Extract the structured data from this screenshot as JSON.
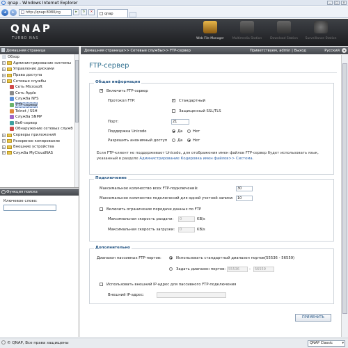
{
  "window": {
    "title": "qnap - Windows Internet Explorer"
  },
  "browser": {
    "url": "http://qnap:8080/cg",
    "tab_label": "qnap"
  },
  "header": {
    "logo": "QNAP",
    "subtitle": "TURBO NAS",
    "apps": [
      {
        "label": "Web File Manager"
      },
      {
        "label": "Multimedia Station"
      },
      {
        "label": "Download Station"
      },
      {
        "label": "Surveillance Station"
      }
    ]
  },
  "breadcrumb": {
    "path": "Домашняя страница>> Сетевые службы>> FTP-сервер",
    "welcome": "Приветствуем, admin | Выход",
    "language": "Русский"
  },
  "sidebar": {
    "title": "Домашняя страница",
    "items": [
      {
        "label": "Обзор",
        "type": "leaf",
        "depth": 0
      },
      {
        "label": "Администрирование системы",
        "type": "folder",
        "depth": 0
      },
      {
        "label": "Управление дисками",
        "type": "folder",
        "depth": 0
      },
      {
        "label": "Права доступа",
        "type": "folder",
        "depth": 0
      },
      {
        "label": "Сетевые службы",
        "type": "folder-open",
        "depth": 0
      },
      {
        "label": "Сеть Microsoft",
        "type": "leaf",
        "depth": 1
      },
      {
        "label": "Сеть Apple",
        "type": "leaf",
        "depth": 1
      },
      {
        "label": "Служба NFS",
        "type": "leaf",
        "depth": 1
      },
      {
        "label": "FTP-сервер",
        "type": "leaf",
        "depth": 1,
        "selected": true
      },
      {
        "label": "Telnet / SSH",
        "type": "leaf",
        "depth": 1
      },
      {
        "label": "Служба SNMP",
        "type": "leaf",
        "depth": 1
      },
      {
        "label": "Веб-сервер",
        "type": "leaf",
        "depth": 1
      },
      {
        "label": "Обнаружение сетевых служб",
        "type": "leaf",
        "depth": 1
      },
      {
        "label": "Серверы приложений",
        "type": "folder",
        "depth": 0
      },
      {
        "label": "Резервное копирование",
        "type": "folder",
        "depth": 0
      },
      {
        "label": "Внешние устройства",
        "type": "folder",
        "depth": 0
      },
      {
        "label": "Служба MyCloudNAS",
        "type": "folder",
        "depth": 0
      }
    ],
    "search_title": "Функция поиска",
    "search_label": "Ключевое слово:"
  },
  "main": {
    "title": "FTP-сервер",
    "general": {
      "legend": "Общая информация",
      "enable_ftp": "Включить FTP-сервер",
      "protocol_label": "Протокол FTP:",
      "protocol_standard": "Стандартный",
      "protocol_ssl": "Защищенный SSL/TLS",
      "port_label": "Порт:",
      "port_value": "21",
      "unicode_label": "Поддержка Unicode",
      "anon_label": "Разрешить анонимный доступ",
      "yes": "Да",
      "no": "Нет",
      "note": "Если FTP-клиент не поддерживает Unicode, для отображения имен файлов FTP-сервер будет использовать язык, указанный в разделе",
      "note_link": "Администрирование Кодировка имен файлов>> Система."
    },
    "connection": {
      "legend": "Подключение",
      "max_all_label": "Максимальное количество всех FTP-подключений:",
      "max_all_value": "30",
      "max_single_label": "Максимальное количество подключений для одной учетной записи:",
      "max_single_value": "10",
      "limit_label": "Включить ограничение передачи данных по FTP",
      "upload_label": "Максимальная скорость раздачи:",
      "upload_value": "0",
      "download_label": "Максимальная скорость загрузки:",
      "download_value": "0",
      "unit": "KB/s"
    },
    "advanced": {
      "legend": "Дополнительно",
      "passive_label": "Диапазон пассивных FTP-портов:",
      "passive_default": "Использовать стандартный диапазон портов(55536 - 56559)",
      "passive_custom": "Задать диапазон портов:",
      "range_from": "55536",
      "range_sep": "-",
      "range_to": "56559",
      "external_ip_label": "Использовать внешний IP-адрес для пассивного FTP-подключения",
      "external_ip_field": "Внешний IP-адрес:"
    },
    "apply_label": "ПРИМЕНИТЬ"
  },
  "footer": {
    "copyright": "© QNAP, Все права защищены",
    "theme": "QNAP Classic"
  }
}
